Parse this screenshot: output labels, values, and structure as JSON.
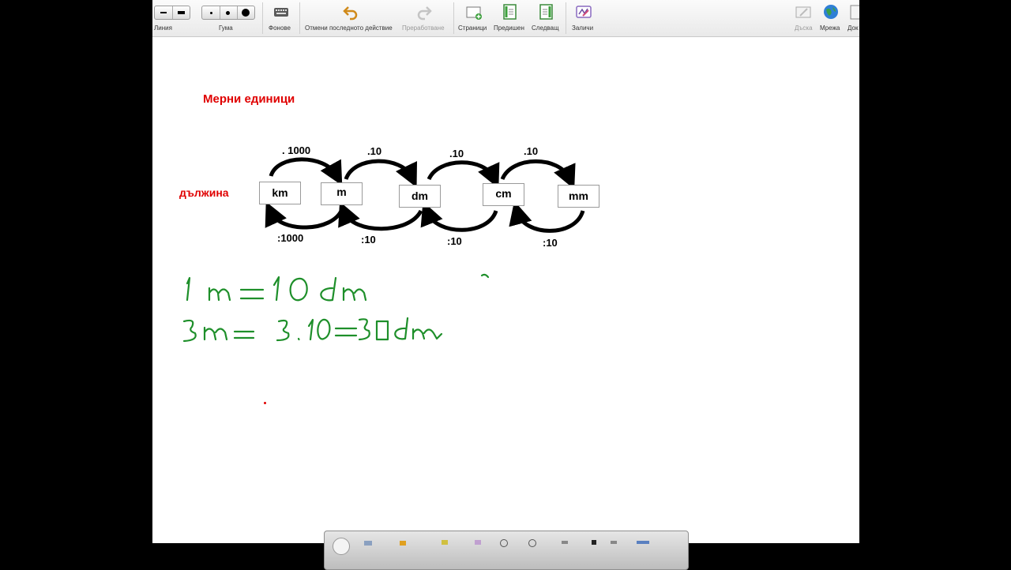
{
  "toolbar": {
    "line_label": "Линия",
    "eraser_label": "Гума",
    "backgrounds_label": "Фонове",
    "undo_label": "Отмени последното действие",
    "redo_label": "Преработване",
    "pages_label": "Страници",
    "prev_label": "Предишен",
    "next_label": "Следващ",
    "clear_label": "Заличи",
    "board_label": "Дъска",
    "network_label": "Мрежа",
    "doc_label": "Док"
  },
  "canvas": {
    "title": "Мерни единици",
    "row_label": "дължина",
    "units": [
      "km",
      "m",
      "dm",
      "cm",
      "mm"
    ],
    "multiply_labels": [
      ". 1000",
      ".10",
      ".10",
      ".10"
    ],
    "divide_labels": [
      ":1000",
      ":10",
      ":10",
      ":10"
    ],
    "handwriting": {
      "line1": "1 m = 10 dm",
      "line2": "3 m = 3.10 = 30 dm",
      "ink_color": "#1e8f2a"
    }
  },
  "colors": {
    "title_red": "#e00000",
    "ink_green": "#1e8f2a"
  }
}
